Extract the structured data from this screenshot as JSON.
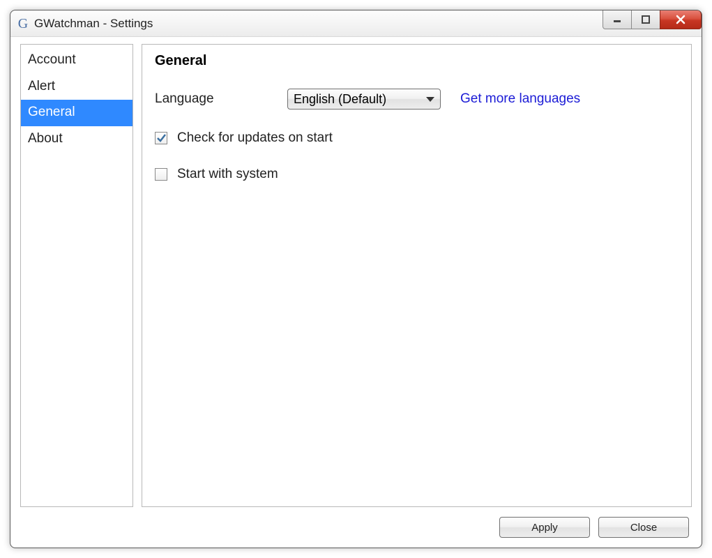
{
  "titlebar": {
    "icon_letter": "G",
    "title": "GWatchman  - Settings"
  },
  "sidebar": {
    "items": [
      {
        "label": "Account",
        "selected": false
      },
      {
        "label": "Alert",
        "selected": false
      },
      {
        "label": "General",
        "selected": true
      },
      {
        "label": "About",
        "selected": false
      }
    ]
  },
  "content": {
    "heading": "General",
    "language_label": "Language",
    "language_value": "English (Default)",
    "more_languages_link": "Get more languages",
    "check_updates_label": "Check for updates on start",
    "check_updates_checked": true,
    "start_with_system_label": "Start with system",
    "start_with_system_checked": false
  },
  "footer": {
    "apply_label": "Apply",
    "close_label": "Close"
  }
}
